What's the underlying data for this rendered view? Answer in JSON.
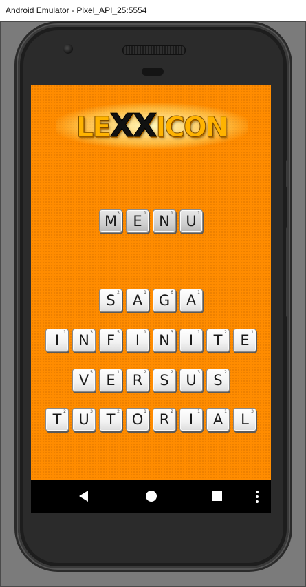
{
  "window": {
    "title": "Android Emulator - Pixel_API_25:5554"
  },
  "app": {
    "logo_text": {
      "pre": "LE",
      "xx": "XX",
      "post": "ICON"
    },
    "menu_tiles": [
      {
        "letter": "M",
        "score": "3"
      },
      {
        "letter": "E",
        "score": "1"
      },
      {
        "letter": "N",
        "score": "1"
      },
      {
        "letter": "U",
        "score": "1"
      }
    ],
    "buttons": [
      {
        "id": "saga",
        "tiles": [
          {
            "letter": "S",
            "score": "2"
          },
          {
            "letter": "A",
            "score": "1"
          },
          {
            "letter": "G",
            "score": "6"
          },
          {
            "letter": "A",
            "score": "1"
          }
        ]
      },
      {
        "id": "infinite",
        "tiles": [
          {
            "letter": "I",
            "score": "1"
          },
          {
            "letter": "N",
            "score": "3"
          },
          {
            "letter": "F",
            "score": "5"
          },
          {
            "letter": "I",
            "score": "1"
          },
          {
            "letter": "N",
            "score": "3"
          },
          {
            "letter": "I",
            "score": "1"
          },
          {
            "letter": "T",
            "score": "2"
          },
          {
            "letter": "E",
            "score": "1"
          }
        ]
      },
      {
        "id": "versus",
        "tiles": [
          {
            "letter": "V",
            "score": "5"
          },
          {
            "letter": "E",
            "score": "1"
          },
          {
            "letter": "R",
            "score": "2"
          },
          {
            "letter": "S",
            "score": "2"
          },
          {
            "letter": "U",
            "score": "3"
          },
          {
            "letter": "S",
            "score": "2"
          }
        ]
      },
      {
        "id": "tutorial",
        "tiles": [
          {
            "letter": "T",
            "score": "2"
          },
          {
            "letter": "U",
            "score": "3"
          },
          {
            "letter": "T",
            "score": "2"
          },
          {
            "letter": "O",
            "score": "1"
          },
          {
            "letter": "R",
            "score": "2"
          },
          {
            "letter": "I",
            "score": "1"
          },
          {
            "letter": "A",
            "score": "1"
          },
          {
            "letter": "L",
            "score": "3"
          }
        ]
      }
    ]
  },
  "nav": {
    "back_icon": "triangle-back-icon",
    "home_icon": "circle-home-icon",
    "recents_icon": "square-recents-icon",
    "more_icon": "vertical-dots-icon"
  },
  "colors": {
    "screen_bg": "#ff8c00",
    "tile_bg": "#f2f2f2",
    "menu_tile_bg": "#d0d0d0",
    "logo_yellow": "#ffb300"
  }
}
